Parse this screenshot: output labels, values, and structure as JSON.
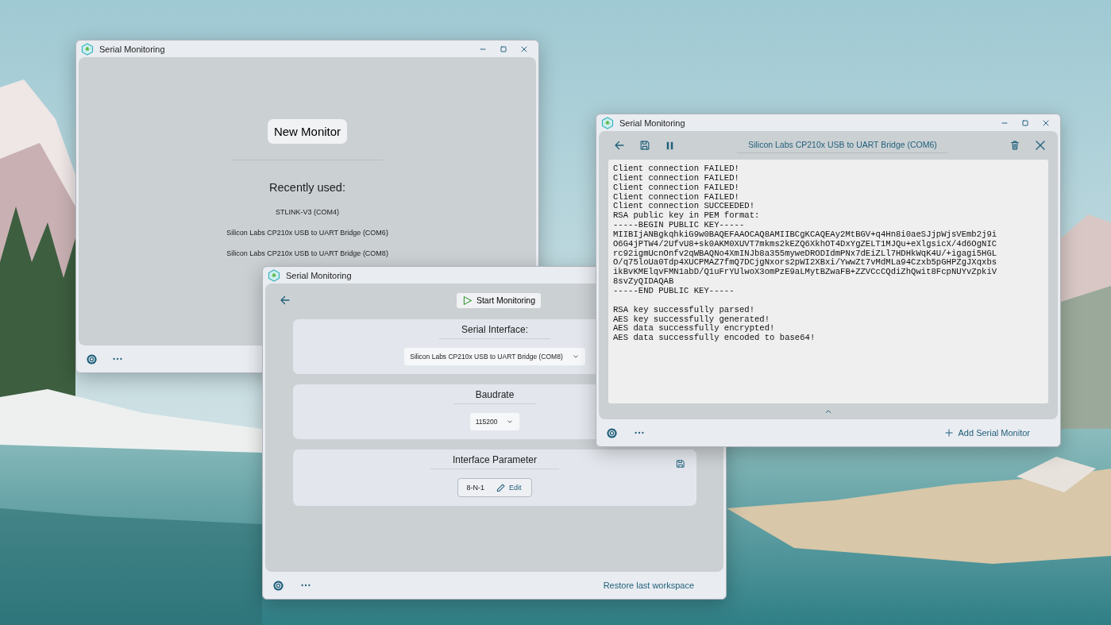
{
  "launcher_window": {
    "title": "Serial Monitoring",
    "new_button": "New Monitor",
    "recent_heading": "Recently used:",
    "recent": [
      "STLINK-V3 (COM4)",
      "Silicon Labs CP210x USB to UART Bridge (COM6)",
      "Silicon Labs CP210x USB to UART Bridge (COM8)"
    ]
  },
  "setup_window": {
    "title": "Serial Monitoring",
    "start_button": "Start Monitoring",
    "cards": [
      {
        "kind": "dropdown",
        "title": "Serial Interface:",
        "value": "Silicon Labs CP210x USB to UART Bridge (COM8)"
      },
      {
        "kind": "dropdown",
        "title": "Baudrate",
        "value": "115200"
      },
      {
        "kind": "parameter",
        "title": "Interface Parameter",
        "value": "8-N-1",
        "action": "Edit"
      }
    ],
    "footer_link": "Restore last workspace"
  },
  "monitor_window": {
    "title": "Serial Monitoring",
    "device": "Silicon Labs CP210x USB to UART Bridge (COM6)",
    "output": [
      [
        "Client connection FAILED!",
        "Client connection FAILED!",
        "Client connection FAILED!",
        "Client connection FAILED!",
        "Client connection SUCCEEDED!",
        "RSA public key in PEM format:",
        "-----BEGIN PUBLIC KEY-----",
        "MIIBIjANBgkqhkiG9w0BAQEFAAOCAQ8AMIIBCgKCAQEAy2MtBGV+q4Hn8i0aeSJjpWjsVEmb2j9i",
        "O6G4jPTW4/2UfvU8+sk0AKM0XUVT7mkms2kEZQ6XkhOT4DxYgZELT1MJQu+eXlgsicX/4d6OgNIC",
        "rc92igmUcnOnfv2qWBAQNo4XmINJb8a355myweDRODIdmPNx7dEiZLl7HDHkWqK4U/+igagi5HGL",
        "O/q75loUa0Tdp4XUCPMAZ7fmQ7DCjgNxors2pWI2XBxi/YwwZt7vMdMLa94Czxb5pGHPZgJXqxbs",
        "ikBvKMElqvFMN1abD/Q1uFrYUlwoX3omPzE9aLMytBZwaFB+ZZVCcCQdiZhQwit8FcpNUYvZpkiV",
        "8svZyQIDAQAB",
        "-----END PUBLIC KEY-----"
      ],
      [
        "RSA key successfully parsed!",
        "AES key successfully generated!",
        "AES data successfully encrypted!",
        "AES data successfully encoded to base64!"
      ]
    ],
    "footer_link": "Add Serial Monitor"
  }
}
